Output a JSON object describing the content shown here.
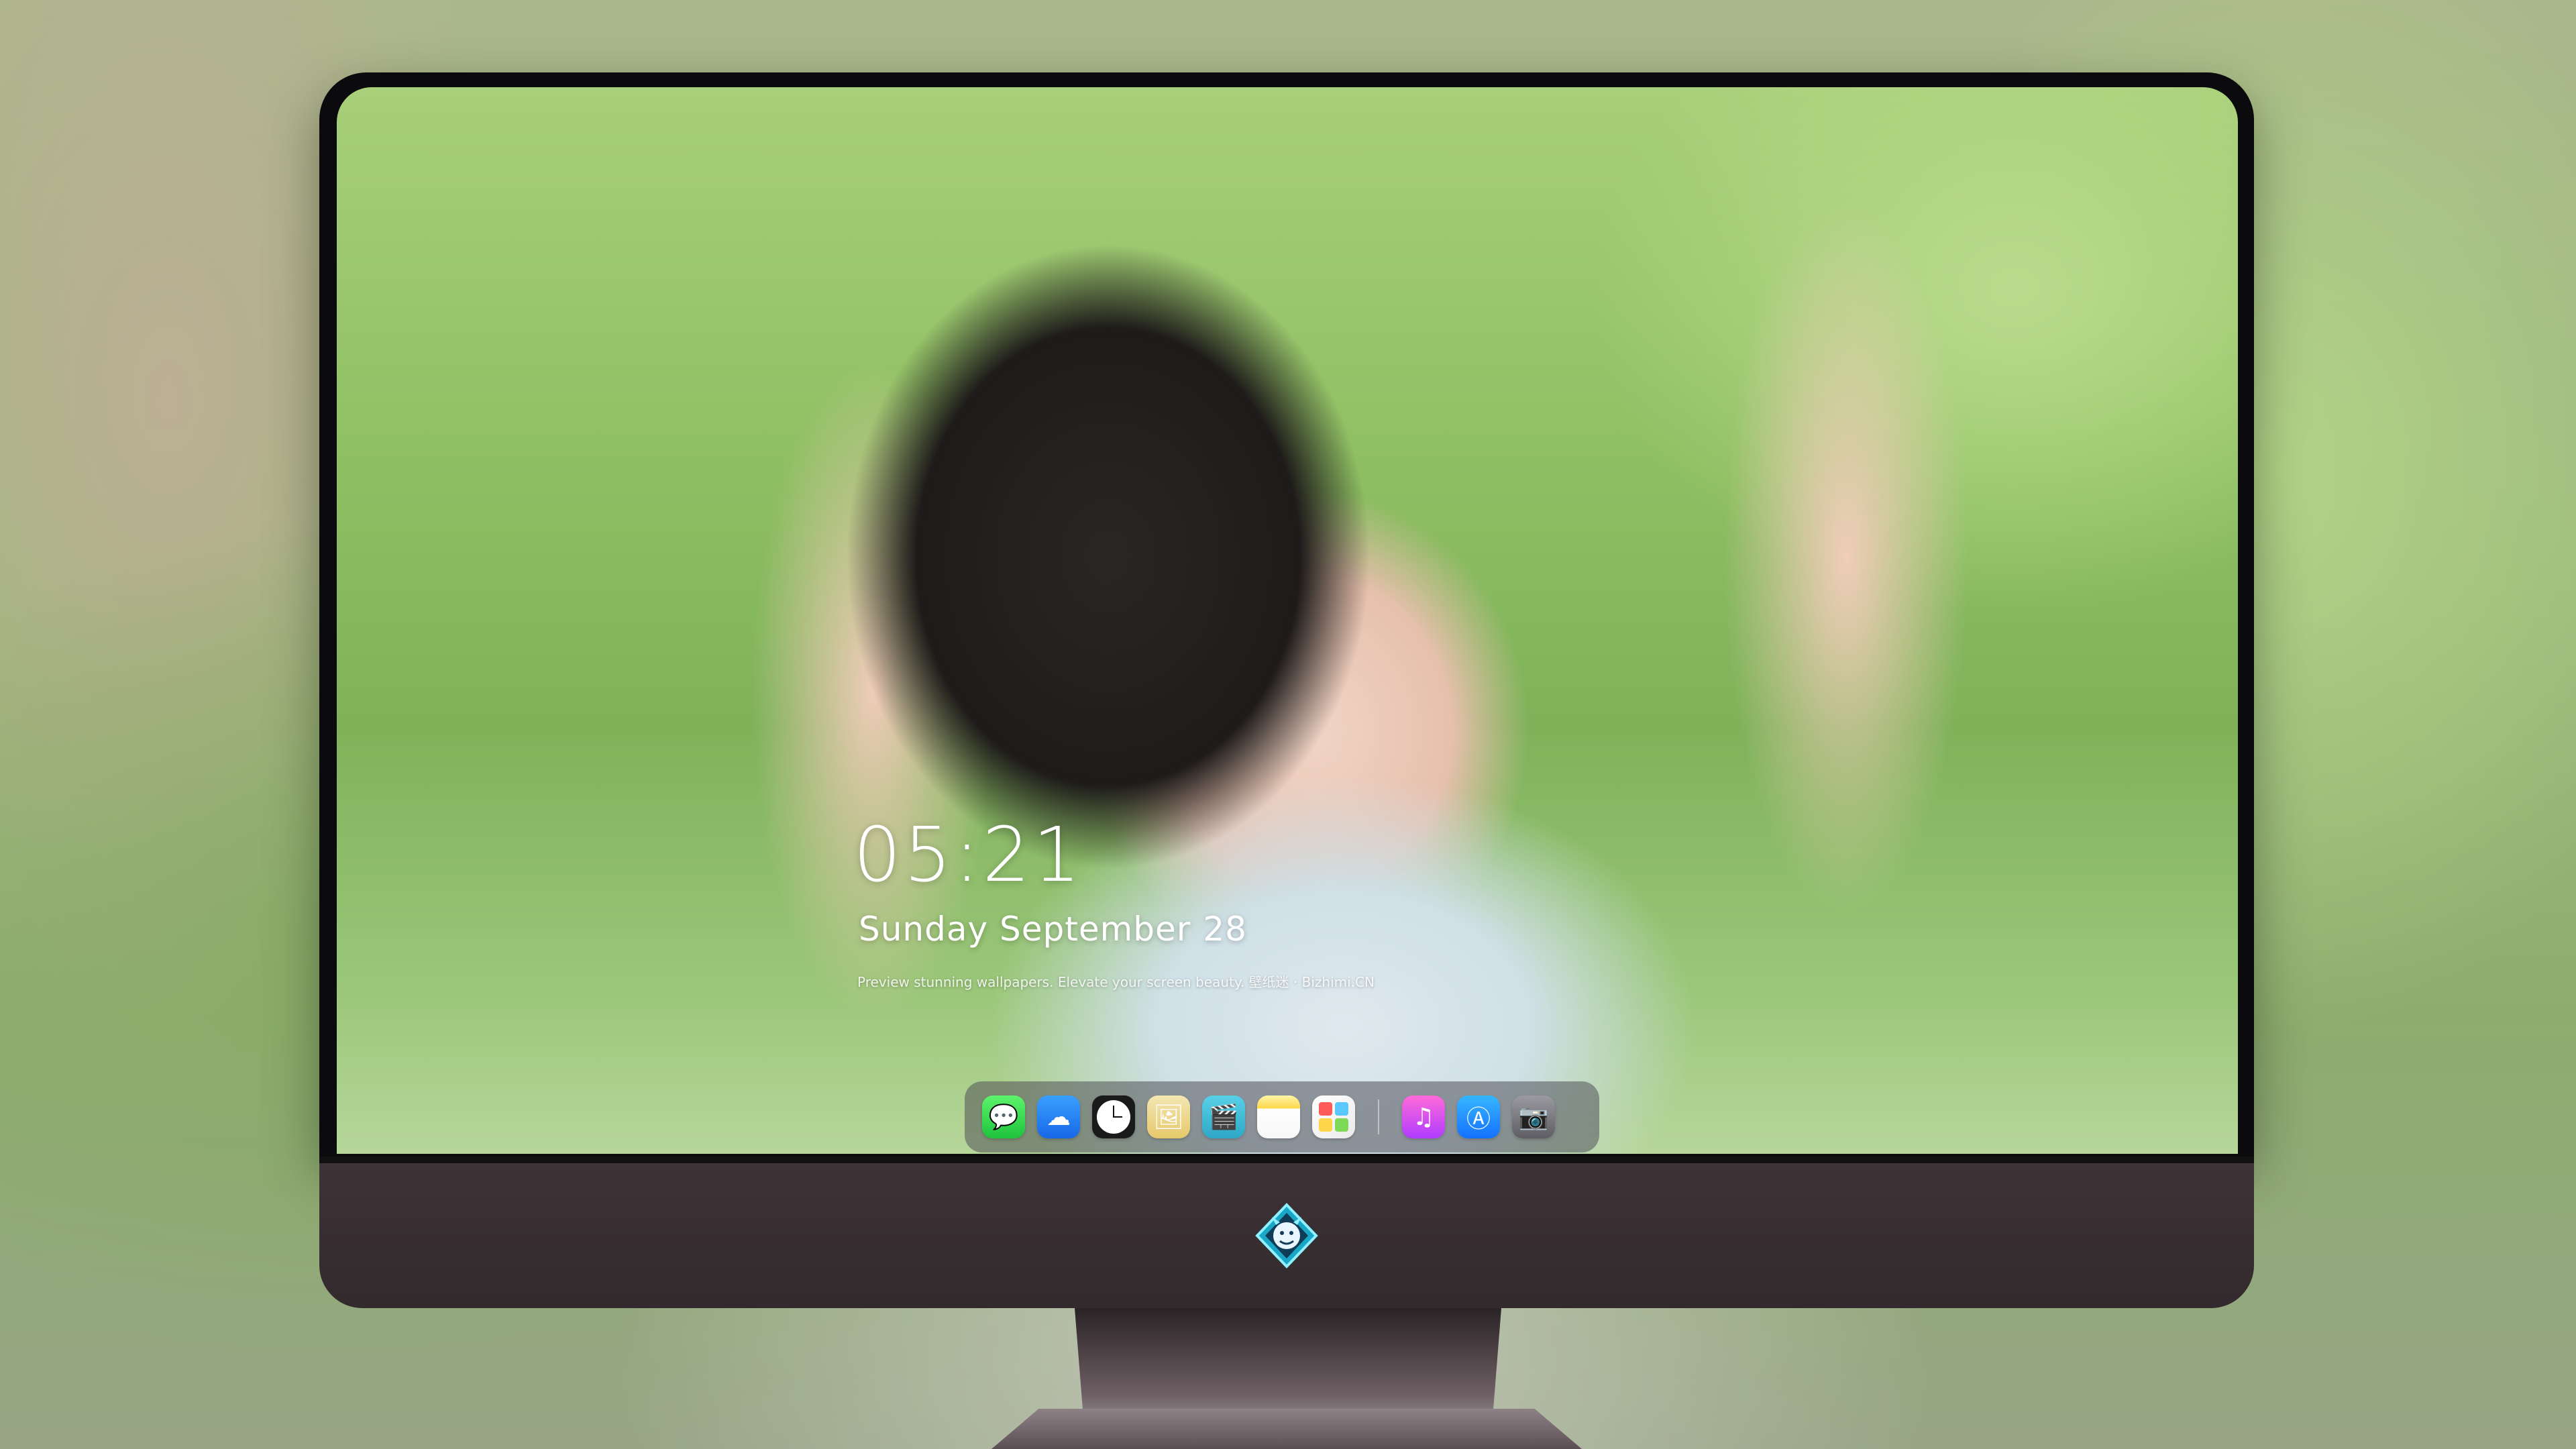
{
  "lockscreen": {
    "time": "05:21",
    "date_text": "Sunday September",
    "day": "28",
    "tagline": "Preview stunning wallpapers. Elevate your screen beauty. 壁纸迷 · Bizhimi.CN"
  },
  "dock": {
    "apps": [
      {
        "name": "messages",
        "icon": "message-bubble-icon",
        "glyph": "💬"
      },
      {
        "name": "weather",
        "icon": "cloud-icon",
        "glyph": "☁"
      },
      {
        "name": "clock",
        "icon": "clock-icon"
      },
      {
        "name": "preview",
        "icon": "preview-icon",
        "glyph": "🖼"
      },
      {
        "name": "video",
        "icon": "clapperboard-icon",
        "glyph": "🎬"
      },
      {
        "name": "notes",
        "icon": "notes-icon"
      },
      {
        "name": "photos",
        "icon": "photos-icon"
      },
      {
        "name": "music",
        "icon": "music-note-icon",
        "glyph": "♫"
      },
      {
        "name": "app-store",
        "icon": "app-store-icon",
        "glyph": "Ⓐ"
      },
      {
        "name": "camera",
        "icon": "camera-icon",
        "glyph": "📷"
      }
    ]
  },
  "colors": {
    "dock_background": "#50505888",
    "chin": "#3e3336",
    "frame": "#0b0b0d",
    "photos_tiles": [
      "#ff5a5a",
      "#5ac8ff",
      "#ffd54a",
      "#7ed957"
    ]
  }
}
